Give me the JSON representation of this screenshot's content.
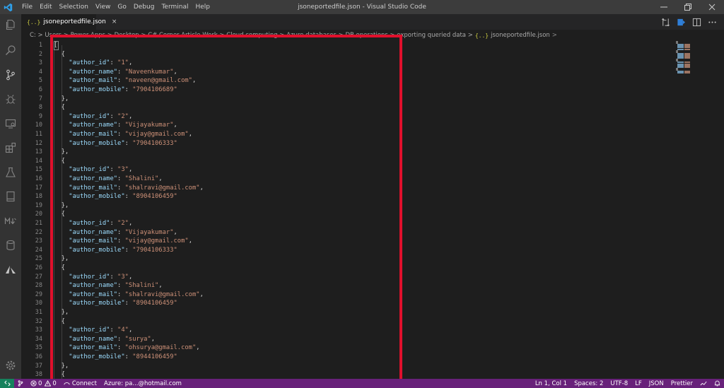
{
  "window": {
    "title": "jsoneportedfile.json - Visual Studio Code",
    "menu": [
      "File",
      "Edit",
      "Selection",
      "View",
      "Go",
      "Debug",
      "Terminal",
      "Help"
    ]
  },
  "tab": {
    "icon": "{..}",
    "label": "jsoneportedfile.json",
    "close": "×"
  },
  "breadcrumb": {
    "path": "C: > Users > Power Apps > Desktop > C# Corner Article Work > Cloud computing > Azure databases > DB operations > exporting queried data >",
    "file_icon": "{..}",
    "file": "jsoneportedfile.json",
    "trailing": ">"
  },
  "editor": {
    "lines": [
      {
        "n": "1",
        "t": "brace",
        "text": "["
      },
      {
        "n": "2",
        "t": "brace",
        "text": "  {"
      },
      {
        "n": "3",
        "t": "kv",
        "key": "\"author_id\"",
        "val": "\"1\"",
        "end": ","
      },
      {
        "n": "4",
        "t": "kv",
        "key": "\"author_name\"",
        "val": "\"Naveenkumar\"",
        "end": ","
      },
      {
        "n": "5",
        "t": "kv",
        "key": "\"author_mail\"",
        "val": "\"naveen@gmail.com\"",
        "end": ","
      },
      {
        "n": "6",
        "t": "kv",
        "key": "\"author_mobile\"",
        "val": "\"7904106689\"",
        "end": ""
      },
      {
        "n": "7",
        "t": "brace",
        "text": "  },"
      },
      {
        "n": "8",
        "t": "brace",
        "text": "  {"
      },
      {
        "n": "9",
        "t": "kv",
        "key": "\"author_id\"",
        "val": "\"2\"",
        "end": ","
      },
      {
        "n": "10",
        "t": "kv",
        "key": "\"author_name\"",
        "val": "\"Vijayakumar\"",
        "end": ","
      },
      {
        "n": "11",
        "t": "kv",
        "key": "\"author_mail\"",
        "val": "\"vijay@gmail.com\"",
        "end": ","
      },
      {
        "n": "12",
        "t": "kv",
        "key": "\"author_mobile\"",
        "val": "\"7904106333\"",
        "end": ""
      },
      {
        "n": "13",
        "t": "brace",
        "text": "  },"
      },
      {
        "n": "14",
        "t": "brace",
        "text": "  {"
      },
      {
        "n": "15",
        "t": "kv",
        "key": "\"author_id\"",
        "val": "\"3\"",
        "end": ","
      },
      {
        "n": "16",
        "t": "kv",
        "key": "\"author_name\"",
        "val": "\"Shalini\"",
        "end": ","
      },
      {
        "n": "17",
        "t": "kv",
        "key": "\"author_mail\"",
        "val": "\"shalravi@gmail.com\"",
        "end": ","
      },
      {
        "n": "18",
        "t": "kv",
        "key": "\"author_mobile\"",
        "val": "\"8904106459\"",
        "end": ""
      },
      {
        "n": "19",
        "t": "brace",
        "text": "  },"
      },
      {
        "n": "20",
        "t": "brace",
        "text": "  {"
      },
      {
        "n": "21",
        "t": "kv",
        "key": "\"author_id\"",
        "val": "\"2\"",
        "end": ","
      },
      {
        "n": "22",
        "t": "kv",
        "key": "\"author_name\"",
        "val": "\"Vijayakumar\"",
        "end": ","
      },
      {
        "n": "23",
        "t": "kv",
        "key": "\"author_mail\"",
        "val": "\"vijay@gmail.com\"",
        "end": ","
      },
      {
        "n": "24",
        "t": "kv",
        "key": "\"author_mobile\"",
        "val": "\"7904106333\"",
        "end": ""
      },
      {
        "n": "25",
        "t": "brace",
        "text": "  },"
      },
      {
        "n": "26",
        "t": "brace",
        "text": "  {"
      },
      {
        "n": "27",
        "t": "kv",
        "key": "\"author_id\"",
        "val": "\"3\"",
        "end": ","
      },
      {
        "n": "28",
        "t": "kv",
        "key": "\"author_name\"",
        "val": "\"Shalini\"",
        "end": ","
      },
      {
        "n": "29",
        "t": "kv",
        "key": "\"author_mail\"",
        "val": "\"shalravi@gmail.com\"",
        "end": ","
      },
      {
        "n": "30",
        "t": "kv",
        "key": "\"author_mobile\"",
        "val": "\"8904106459\"",
        "end": ""
      },
      {
        "n": "31",
        "t": "brace",
        "text": "  },"
      },
      {
        "n": "32",
        "t": "brace",
        "text": "  {"
      },
      {
        "n": "33",
        "t": "kv",
        "key": "\"author_id\"",
        "val": "\"4\"",
        "end": ","
      },
      {
        "n": "34",
        "t": "kv",
        "key": "\"author_name\"",
        "val": "\"surya\"",
        "end": ","
      },
      {
        "n": "35",
        "t": "kv",
        "key": "\"author_mail\"",
        "val": "\"ohsurya@gmail.com\"",
        "end": ","
      },
      {
        "n": "36",
        "t": "kv",
        "key": "\"author_mobile\"",
        "val": "\"8944106459\"",
        "end": ""
      },
      {
        "n": "37",
        "t": "brace",
        "text": "  },"
      },
      {
        "n": "38",
        "t": "brace",
        "text": "  {"
      }
    ]
  },
  "statusbar": {
    "errors": "0",
    "warnings": "0",
    "extra": "Connect",
    "account": "Azure: pa...@hotmail.com",
    "position": "Ln 1, Col 1",
    "spaces": "Spaces: 2",
    "encoding": "UTF-8",
    "eol": "LF",
    "language": "JSON",
    "formatter": "Prettier"
  },
  "colors": {
    "highlight_box": "#e0102c",
    "statusbar": "#68217a",
    "json_key": "#9cdcfe",
    "json_string": "#ce9178"
  },
  "icons": {
    "activity": [
      "explorer-icon",
      "search-icon",
      "source-control-icon",
      "debug-icon",
      "remote-explorer-icon",
      "extensions-icon",
      "test-icon",
      "book-icon",
      "markdown-icon",
      "database-icon",
      "azure-icon",
      "gear-icon"
    ]
  }
}
